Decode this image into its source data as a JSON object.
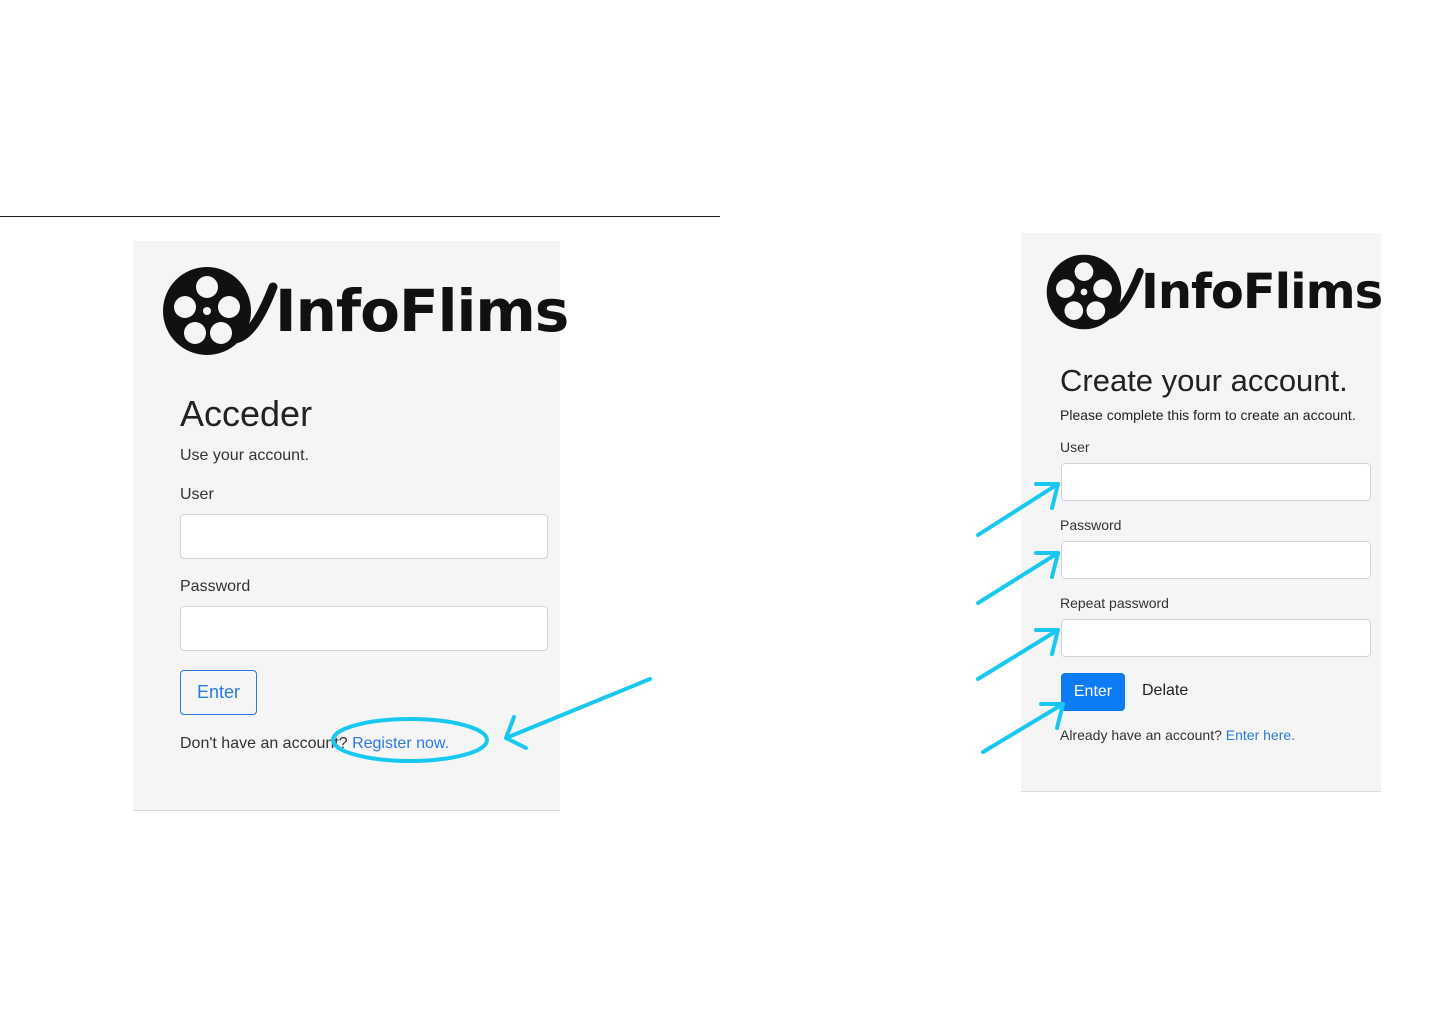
{
  "login": {
    "logo_text": "InfoFlims",
    "title": "Acceder",
    "subtitle": "Use your account.",
    "user_label": "User",
    "password_label": "Password",
    "enter_label": "Enter",
    "footer_text": "Don't have an account?",
    "register_link": "Register now."
  },
  "register": {
    "logo_text": "InfoFlims",
    "title": "Create your account.",
    "subtitle": "Please complete this form to create an account.",
    "user_label": "User",
    "password_label": "Password",
    "repeat_password_label": "Repeat password",
    "enter_label": "Enter",
    "delete_label": "Delate",
    "footer_text": "Already have an account?",
    "enter_link": "Enter here."
  },
  "colors": {
    "annotation": "#19c8f0",
    "link": "#2a7ae2",
    "primary_button": "#0d7bf4",
    "panel_bg": "#f5f5f5"
  }
}
